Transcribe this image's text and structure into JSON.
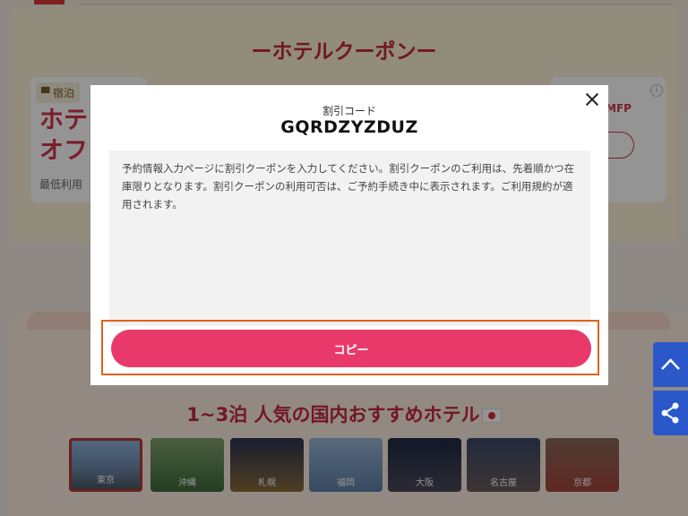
{
  "background": {
    "section_title": "ーホテルクーポンー",
    "card_left": {
      "badge": "宿泊",
      "big_text_line1": "ホテ",
      "big_text_line2": "オフ",
      "small_text": "最低利用"
    },
    "card_right": {
      "mfp_text": "MFP",
      "info": "i"
    },
    "hotels_title": "1~3泊 人気の国内おすすめホテル",
    "cities": [
      "東京",
      "沖縄",
      "札幌",
      "福岡",
      "大阪",
      "名古屋",
      "京都"
    ]
  },
  "modal": {
    "code_label": "割引コード",
    "code_value": "GQRDZYZDUZ",
    "terms": "予約情報入力ページに割引クーポンを入力してください。割引クーポンのご利用は、先着順かつ在庫限りとなります。割引クーポンの利用可否は、ご予約手続き中に表示されます。ご利用規約が適用されます。",
    "copy_label": "コピー"
  },
  "colors": {
    "accent": "#e8396a",
    "highlight": "#e0611f",
    "title_red": "#c4283f",
    "side_blue": "#2a57c9"
  }
}
